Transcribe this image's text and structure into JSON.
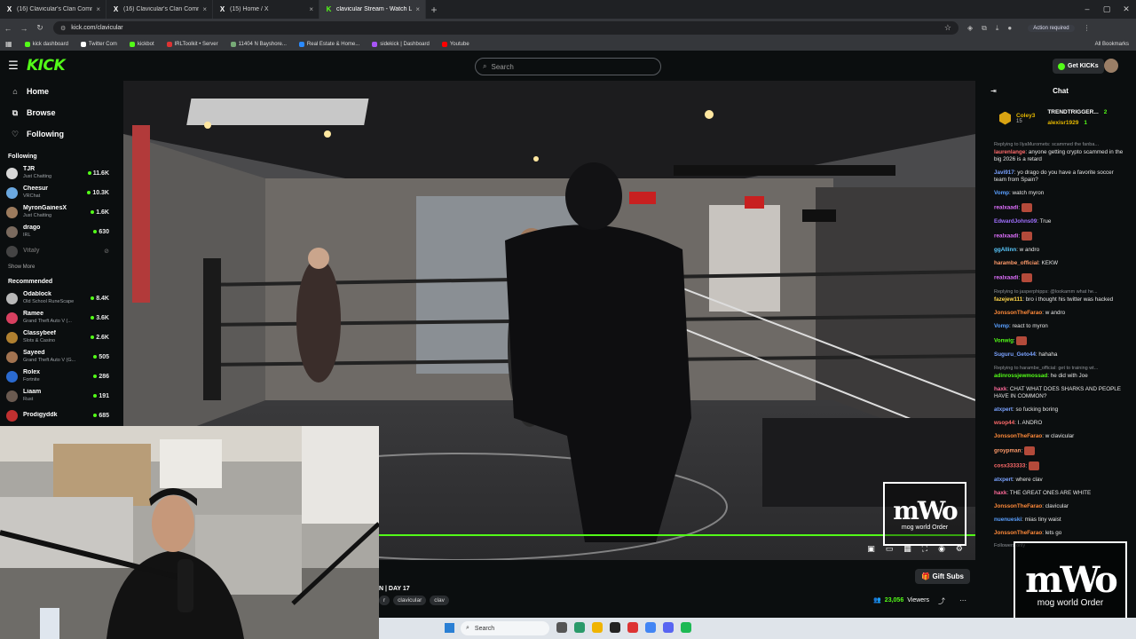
{
  "browser": {
    "tabs": [
      {
        "title": "(16) Clavicular's Clan Communi",
        "favicon": "x-icon"
      },
      {
        "title": "(16) Clavicular's Clan Communi",
        "favicon": "x-icon"
      },
      {
        "title": "(15) Home / X",
        "favicon": "x-icon"
      },
      {
        "title": "clavicular Stream - Watch Li",
        "favicon": "kick-icon",
        "active": true
      }
    ],
    "url": "kick.com/clavicular",
    "action_required": "Action required",
    "bookmarks": [
      "kick dashboard",
      "Twitter Com",
      "kickbot",
      "IRLToolkit • Server",
      "11404 N Bayshore...",
      "Real Estate & Home...",
      "sidekick | Dashboard",
      "Youtube"
    ],
    "all_bookmarks": "All Bookmarks"
  },
  "header": {
    "logo": "KICK",
    "search_placeholder": "Search",
    "get_kicks": "Get KICKs"
  },
  "sidebar": {
    "nav": [
      {
        "label": "Home",
        "icon": "home-icon"
      },
      {
        "label": "Browse",
        "icon": "browse-icon"
      },
      {
        "label": "Following",
        "icon": "heart-icon"
      }
    ],
    "following_title": "Following",
    "following": [
      {
        "name": "TJR",
        "category": "Just Chatting",
        "viewers": "11.6K",
        "color": "#d8d8d8"
      },
      {
        "name": "Cheesur",
        "category": "VRChat",
        "viewers": "10.3K",
        "color": "#6aa8e0"
      },
      {
        "name": "MyronGainesX",
        "category": "Just Chatting",
        "viewers": "1.6K",
        "color": "#9c7b5d"
      },
      {
        "name": "drago",
        "category": "IRL",
        "viewers": "630",
        "color": "#7a6a5e"
      },
      {
        "name": "Vitaly",
        "category": "",
        "viewers": "",
        "color": "#444",
        "offline": true
      }
    ],
    "show_more": "Show More",
    "recommended_title": "Recommended",
    "recommended": [
      {
        "name": "Odablock",
        "category": "Old School RuneScape",
        "viewers": "8.4K",
        "color": "#b8b8b8"
      },
      {
        "name": "Ramee",
        "category": "Grand Theft Auto V (...",
        "viewers": "3.6K",
        "color": "#d84060"
      },
      {
        "name": "Classybeef",
        "category": "Slots & Casino",
        "viewers": "2.6K",
        "color": "#b08030"
      },
      {
        "name": "Sayeed",
        "category": "Grand Theft Auto V (G...",
        "viewers": "505",
        "color": "#a27350"
      },
      {
        "name": "Rolex",
        "category": "Fortnite",
        "viewers": "286",
        "color": "#2a6ad0"
      },
      {
        "name": "Liaam",
        "category": "Rust",
        "viewers": "191",
        "color": "#6a5a50"
      },
      {
        "name": "Prodigyddk",
        "category": "",
        "viewers": "685",
        "color": "#c03030"
      }
    ]
  },
  "stream": {
    "title": "N | DAY 17",
    "tags": [
      "r",
      "clavicular",
      "clav"
    ],
    "gift_subs": "Gift Subs",
    "viewers": "23,056",
    "viewers_label": "Viewers",
    "watermark_big": "mWo",
    "watermark_small": "mog world Order"
  },
  "chat": {
    "title": "Chat",
    "pinned_user": "Coley3",
    "pinned_count": "15",
    "top1": "TRENDTRIGGER...",
    "top1_n": "2",
    "top2": "alexisr1929",
    "top2_n": "1",
    "messages": [
      {
        "reply": "Replying to IlyaMuromets: scammed the fanba...",
        "user": "laurenlange",
        "color": "#ff6b6b",
        "text": ": anyone getting crypto scammed in the big 2026 is a retard"
      },
      {
        "user": "Javi917",
        "color": "#7aa2ff",
        "text": ": yo drago do you have a favorite soccer team from Spain?"
      },
      {
        "user": "Vomp",
        "color": "#5aa0ff",
        "text": ": watch myron"
      },
      {
        "user": "realxaadi",
        "color": "#e070ff",
        "text": ":",
        "emote": true
      },
      {
        "user": "EdwardJohns09",
        "color": "#a070ff",
        "text": ": True"
      },
      {
        "user": "realxaadi",
        "color": "#e070ff",
        "text": ":",
        "emote": true
      },
      {
        "user": "ggAllinn",
        "color": "#5acaff",
        "text": ": w andro"
      },
      {
        "user": "harambe_official",
        "color": "#ff9a6a",
        "text": ": KEKW"
      },
      {
        "user": "realxaadi",
        "color": "#e070ff",
        "text": ":",
        "emote": true
      },
      {
        "reply": "Replying to jasperphipps: @lookamm what he...",
        "user": "fazejew111",
        "color": "#ffd54a",
        "text": ": bro i thought his twitter was hacked"
      },
      {
        "user": "JonssonTheFarao",
        "color": "#ff8a3a",
        "text": ": w andro"
      },
      {
        "user": "Vomp",
        "color": "#5aa0ff",
        "text": ": react to myron"
      },
      {
        "user": "Vonwig",
        "color": "#53fc18",
        "text": ":",
        "emote": true
      },
      {
        "user": "Suguru_Geto44",
        "color": "#7aa2ff",
        "text": ": hahaha"
      },
      {
        "reply": "Replying to harambe_official: get to training wt...",
        "user": "adinrossjewmossad",
        "color": "#53fc18",
        "text": ": he did with Joe"
      },
      {
        "user": "haxk",
        "color": "#ff6b9a",
        "text": ": CHAT WHAT DOES SHARKS AND PEOPLE HAVE IN COMMON?"
      },
      {
        "user": "atxpert",
        "color": "#7aa2ff",
        "text": ": so fucking boring"
      },
      {
        "user": "wsop44",
        "color": "#ff6b6b",
        "text": ": I. ANDRO"
      },
      {
        "user": "JonssonTheFarao",
        "color": "#ff8a3a",
        "text": ": w clavicular"
      },
      {
        "user": "groypman",
        "color": "#ff9a6a",
        "text": ":",
        "emote": true
      },
      {
        "user": "cosx333333",
        "color": "#ff6b6b",
        "text": ":",
        "emote": true
      },
      {
        "user": "atxpert",
        "color": "#7aa2ff",
        "text": ": where clav"
      },
      {
        "user": "haxk",
        "color": "#ff6b9a",
        "text": ": THE GREAT ONES ARE WHITE"
      },
      {
        "user": "JonssonTheFarao",
        "color": "#ff8a3a",
        "text": ": clavicular"
      },
      {
        "user": "nuenueski",
        "color": "#5aa0ff",
        "text": ": mias tiny waist"
      },
      {
        "user": "JonssonTheFarao",
        "color": "#ff8a3a",
        "text": ": lets go"
      }
    ],
    "followers_only": "Followers only"
  },
  "taskbar": {
    "search": "Search"
  }
}
